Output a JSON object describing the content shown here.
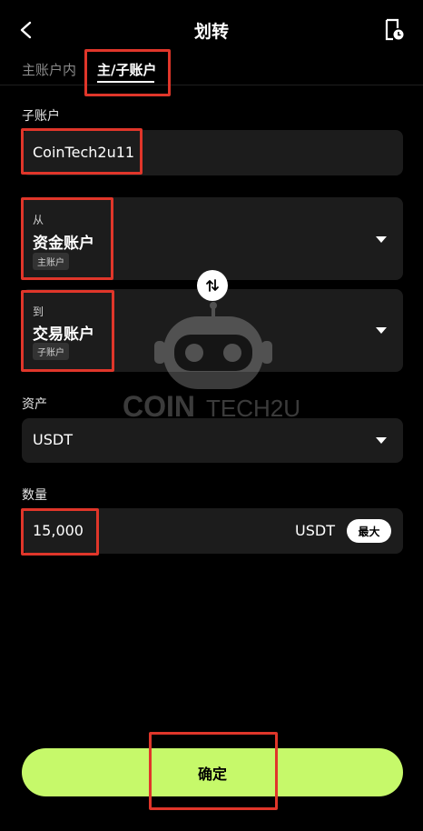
{
  "header": {
    "title": "划转",
    "back_icon": "chevron-left-icon",
    "history_icon": "document-clock-icon"
  },
  "tabs": [
    {
      "label": "主账户内"
    },
    {
      "label": "主/子账户"
    }
  ],
  "subaccount": {
    "label": "子账户",
    "value": "CoinTech2u11"
  },
  "from": {
    "label": "从",
    "account": "资金账户",
    "tag": "主账户"
  },
  "to": {
    "label": "到",
    "account": "交易账户",
    "tag": "子账户"
  },
  "asset": {
    "label": "资产",
    "value": "USDT"
  },
  "amount": {
    "label": "数量",
    "value": "15,000",
    "unit": "USDT",
    "max_label": "最大"
  },
  "watermark": {
    "text_bold": "COIN",
    "text_light": "TECH2U"
  },
  "confirm_label": "确定",
  "colors": {
    "accent": "#c6f96a",
    "highlight": "#e0362a",
    "background": "#000000",
    "field": "#1c1c1c"
  }
}
